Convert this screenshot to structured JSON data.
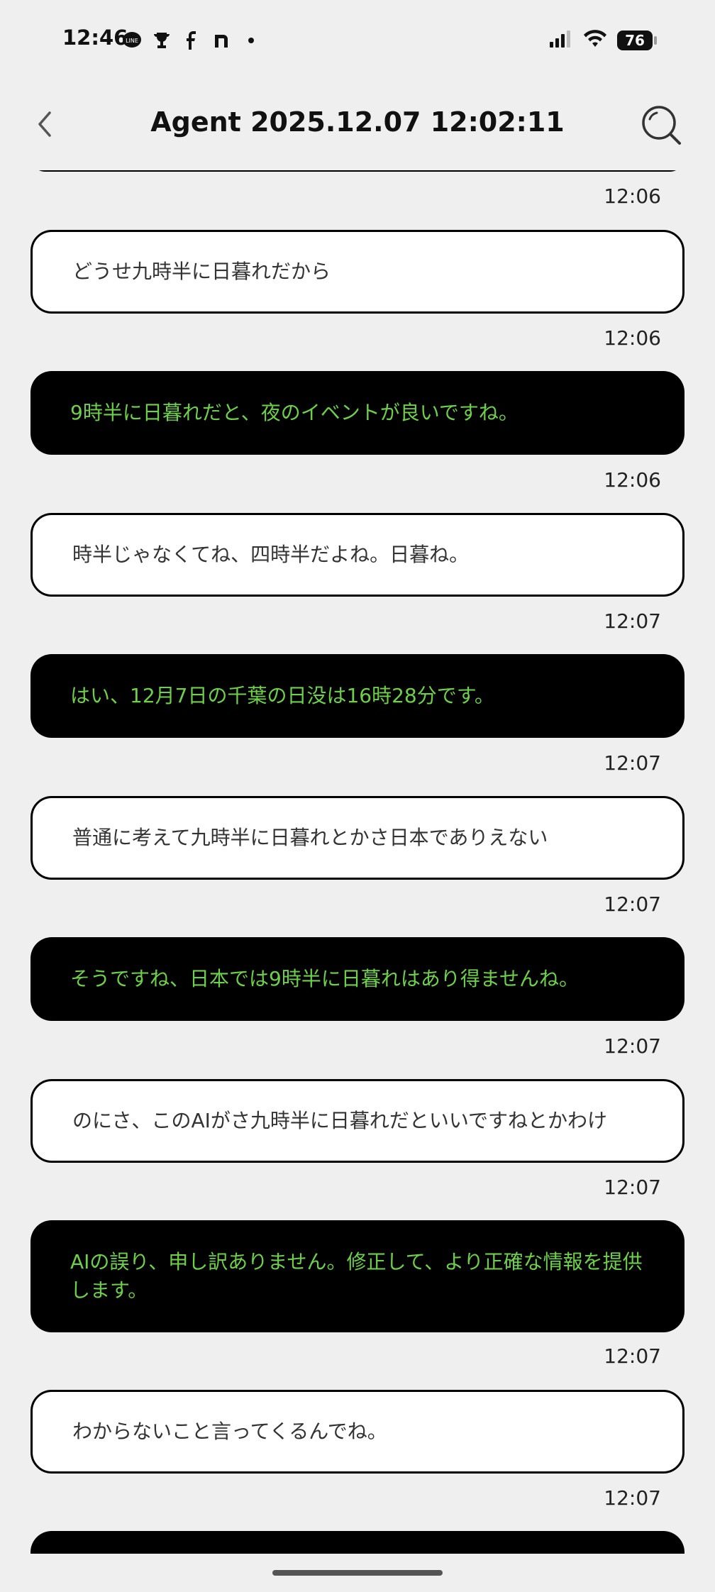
{
  "status": {
    "time": "12:46",
    "battery": "76",
    "left_icons": [
      "line-icon",
      "trophy-icon",
      "facebook-icon",
      "n-icon",
      "dot-icon"
    ]
  },
  "header": {
    "title": "Agent 2025.12.07 12:02:11"
  },
  "messages": [
    {
      "role": "agent",
      "text": "",
      "time": "12:06"
    },
    {
      "role": "user",
      "text": "どうせ九時半に日暮れだから",
      "time": "12:06"
    },
    {
      "role": "agent",
      "text": "9時半に日暮れだと、夜のイベントが良いですね。",
      "time": "12:06"
    },
    {
      "role": "user",
      "text": "時半じゃなくてね、四時半だよね。日暮ね。",
      "time": "12:07"
    },
    {
      "role": "agent",
      "text": "はい、12月7日の千葉の日没は16時28分です。",
      "time": "12:07"
    },
    {
      "role": "user",
      "text": "普通に考えて九時半に日暮れとかさ日本でありえない",
      "time": "12:07"
    },
    {
      "role": "agent",
      "text": "そうですね、日本では9時半に日暮れはあり得ませんね。",
      "time": "12:07"
    },
    {
      "role": "user",
      "text": "のにさ、このAIがさ九時半に日暮れだといいですねとかわけ",
      "time": "12:07"
    },
    {
      "role": "agent",
      "text": "AIの誤り、申し訳ありません。修正して、より正確な情報を提供します。",
      "time": "12:07"
    },
    {
      "role": "user",
      "text": "わからないこと言ってくるんでね。",
      "time": "12:07"
    },
    {
      "role": "agent",
      "text": "",
      "time": ""
    }
  ],
  "colors": {
    "background": "#efefef",
    "agent_bubble": "#000000",
    "agent_text": "#6ecf4a",
    "user_bubble": "#ffffff"
  }
}
